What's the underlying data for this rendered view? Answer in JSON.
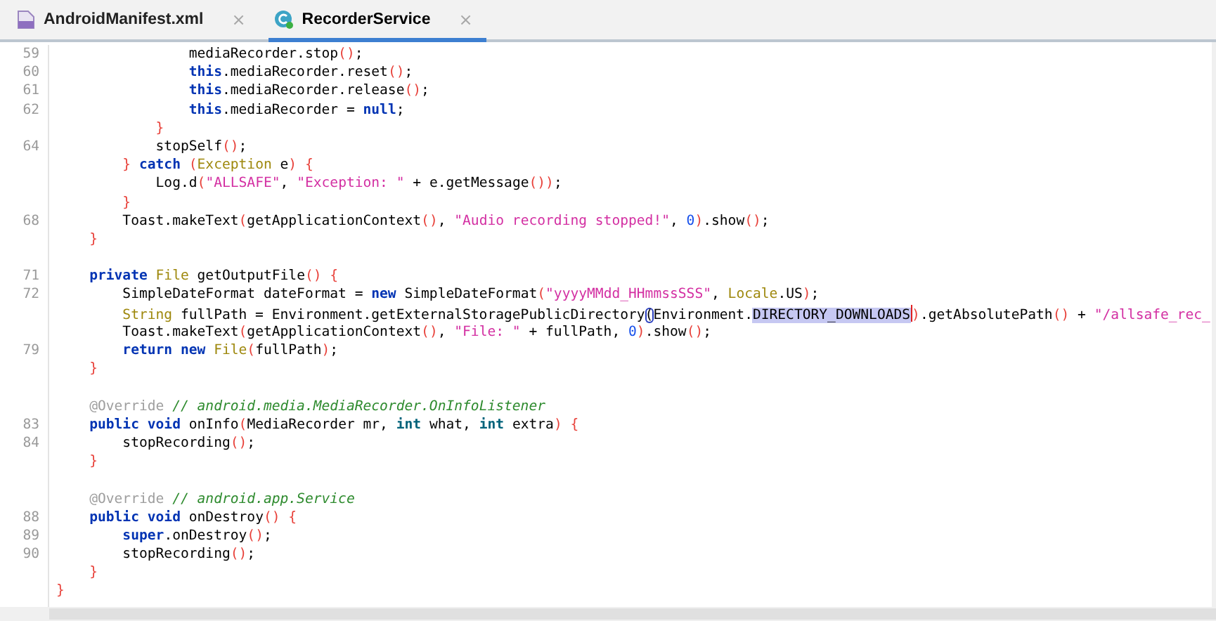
{
  "tabs": [
    {
      "label": "AndroidManifest.xml",
      "close": "×",
      "kind": "manifest",
      "selected": false
    },
    {
      "label": "RecorderService",
      "close": "×",
      "kind": "class",
      "selected": true
    }
  ],
  "lines": [
    {
      "kind": "code",
      "number": "59",
      "tokens": [
        {
          "kind": "plain",
          "text": "                mediaRecorder.stop"
        },
        {
          "kind": "bracket",
          "text": "()"
        },
        {
          "kind": "plain",
          "text": ";"
        }
      ]
    },
    {
      "kind": "code",
      "number": "60",
      "tokens": [
        {
          "kind": "keyword",
          "text": "                this"
        },
        {
          "kind": "plain",
          "text": ".mediaRecorder.reset"
        },
        {
          "kind": "bracket",
          "text": "()"
        },
        {
          "kind": "plain",
          "text": ";"
        }
      ]
    },
    {
      "kind": "code",
      "number": "61",
      "tokens": [
        {
          "kind": "keyword",
          "text": "                this"
        },
        {
          "kind": "plain",
          "text": ".mediaRecorder.release"
        },
        {
          "kind": "bracket",
          "text": "()"
        },
        {
          "kind": "plain",
          "text": ";"
        }
      ]
    },
    {
      "kind": "code",
      "number": "62",
      "tokens": [
        {
          "kind": "keyword",
          "text": "                this"
        },
        {
          "kind": "plain",
          "text": ".mediaRecorder = "
        },
        {
          "kind": "keyword",
          "text": "null"
        },
        {
          "kind": "plain",
          "text": ";"
        }
      ]
    },
    {
      "kind": "code",
      "tokens": [
        {
          "kind": "bracket",
          "text": "            }"
        }
      ]
    },
    {
      "kind": "code",
      "number": "64",
      "tokens": [
        {
          "kind": "plain",
          "text": "            stopSelf"
        },
        {
          "kind": "bracket",
          "text": "()"
        },
        {
          "kind": "plain",
          "text": ";"
        }
      ]
    },
    {
      "kind": "code",
      "tokens": [
        {
          "kind": "bracket",
          "text": "        } "
        },
        {
          "kind": "keyword",
          "text": "catch"
        },
        {
          "kind": "bracket",
          "text": " ("
        },
        {
          "kind": "type",
          "text": "Exception"
        },
        {
          "kind": "plain",
          "text": " e"
        },
        {
          "kind": "bracket",
          "text": ") {"
        }
      ]
    },
    {
      "kind": "code",
      "tokens": [
        {
          "kind": "plain",
          "text": "            Log.d"
        },
        {
          "kind": "bracket",
          "text": "("
        },
        {
          "kind": "string",
          "text": "\"ALLSAFE\""
        },
        {
          "kind": "plain",
          "text": ", "
        },
        {
          "kind": "string",
          "text": "\"Exception: \""
        },
        {
          "kind": "plain",
          "text": " + e.getMessage"
        },
        {
          "kind": "bracket",
          "text": "())"
        },
        {
          "kind": "plain",
          "text": ";"
        }
      ]
    },
    {
      "kind": "code",
      "tokens": [
        {
          "kind": "bracket",
          "text": "        }"
        }
      ]
    },
    {
      "kind": "code",
      "number": "68",
      "tokens": [
        {
          "kind": "plain",
          "text": "        Toast.makeText"
        },
        {
          "kind": "bracket",
          "text": "("
        },
        {
          "kind": "plain",
          "text": "getApplicationContext"
        },
        {
          "kind": "bracket",
          "text": "()"
        },
        {
          "kind": "plain",
          "text": ", "
        },
        {
          "kind": "string",
          "text": "\"Audio recording stopped!\""
        },
        {
          "kind": "plain",
          "text": ", "
        },
        {
          "kind": "number",
          "text": "0"
        },
        {
          "kind": "bracket",
          "text": ")"
        },
        {
          "kind": "plain",
          "text": ".show"
        },
        {
          "kind": "bracket",
          "text": "()"
        },
        {
          "kind": "plain",
          "text": ";"
        }
      ]
    },
    {
      "kind": "code",
      "tokens": [
        {
          "kind": "bracket",
          "text": "    }"
        }
      ]
    },
    {
      "kind": "blank"
    },
    {
      "kind": "code",
      "number": "71",
      "tokens": [
        {
          "kind": "keyword",
          "text": "    private"
        },
        {
          "kind": "type",
          "text": " File"
        },
        {
          "kind": "plain",
          "text": " getOutputFile"
        },
        {
          "kind": "bracket",
          "text": "() {"
        }
      ]
    },
    {
      "kind": "code",
      "number": "72",
      "tokens": [
        {
          "kind": "plain",
          "text": "        SimpleDateFormat dateFormat = "
        },
        {
          "kind": "keyword",
          "text": "new"
        },
        {
          "kind": "plain",
          "text": " SimpleDateFormat"
        },
        {
          "kind": "bracket",
          "text": "("
        },
        {
          "kind": "string",
          "text": "\"yyyyMMdd_HHmmssSSS\""
        },
        {
          "kind": "plain",
          "text": ", "
        },
        {
          "kind": "type",
          "text": "Locale"
        },
        {
          "kind": "plain",
          "text": ".US"
        },
        {
          "kind": "bracket",
          "text": ")"
        },
        {
          "kind": "plain",
          "text": ";"
        }
      ]
    },
    {
      "kind": "code",
      "tokens": [
        {
          "kind": "type",
          "text": "        String"
        },
        {
          "kind": "plain",
          "text": " fullPath = Environment.getExternalStoragePublicDirectory"
        },
        {
          "kind": "matched",
          "text": "("
        },
        {
          "kind": "plain",
          "text": "Environment."
        },
        {
          "kind": "highlight",
          "text": "DIRECTORY_DOWNLOADS",
          "cursor_after": true
        },
        {
          "kind": "bracket",
          "text": ")"
        },
        {
          "kind": "plain",
          "text": ".getAbsolutePath"
        },
        {
          "kind": "bracket",
          "text": "()"
        },
        {
          "kind": "plain",
          "text": " + "
        },
        {
          "kind": "string",
          "text": "\"/allsafe_rec_"
        }
      ]
    },
    {
      "kind": "code",
      "tokens": [
        {
          "kind": "plain",
          "text": "        Toast.makeText"
        },
        {
          "kind": "bracket",
          "text": "("
        },
        {
          "kind": "plain",
          "text": "getApplicationContext"
        },
        {
          "kind": "bracket",
          "text": "()"
        },
        {
          "kind": "plain",
          "text": ", "
        },
        {
          "kind": "string",
          "text": "\"File: \""
        },
        {
          "kind": "plain",
          "text": " + fullPath, "
        },
        {
          "kind": "number",
          "text": "0"
        },
        {
          "kind": "bracket",
          "text": ")"
        },
        {
          "kind": "plain",
          "text": ".show"
        },
        {
          "kind": "bracket",
          "text": "()"
        },
        {
          "kind": "plain",
          "text": ";"
        }
      ]
    },
    {
      "kind": "code",
      "number": "79",
      "tokens": [
        {
          "kind": "keyword",
          "text": "        return new"
        },
        {
          "kind": "type",
          "text": " File"
        },
        {
          "kind": "bracket",
          "text": "("
        },
        {
          "kind": "plain",
          "text": "fullPath"
        },
        {
          "kind": "bracket",
          "text": ")"
        },
        {
          "kind": "plain",
          "text": ";"
        }
      ]
    },
    {
      "kind": "code",
      "tokens": [
        {
          "kind": "bracket",
          "text": "    }"
        }
      ]
    },
    {
      "kind": "blank"
    },
    {
      "kind": "code",
      "tokens": [
        {
          "kind": "annotation",
          "text": "    @Override"
        },
        {
          "kind": "comment",
          "text": " // android.media.MediaRecorder.OnInfoListener"
        }
      ]
    },
    {
      "kind": "code",
      "number": "83",
      "tokens": [
        {
          "kind": "keyword",
          "text": "    public void"
        },
        {
          "kind": "plain",
          "text": " onInfo"
        },
        {
          "kind": "bracket",
          "text": "("
        },
        {
          "kind": "plain",
          "text": "MediaRecorder mr, "
        },
        {
          "kind": "primitive",
          "text": "int"
        },
        {
          "kind": "plain",
          "text": " what, "
        },
        {
          "kind": "primitive",
          "text": "int"
        },
        {
          "kind": "plain",
          "text": " extra"
        },
        {
          "kind": "bracket",
          "text": ") {"
        }
      ]
    },
    {
      "kind": "code",
      "number": "84",
      "tokens": [
        {
          "kind": "plain",
          "text": "        stopRecording"
        },
        {
          "kind": "bracket",
          "text": "()"
        },
        {
          "kind": "plain",
          "text": ";"
        }
      ]
    },
    {
      "kind": "code",
      "tokens": [
        {
          "kind": "bracket",
          "text": "    }"
        }
      ]
    },
    {
      "kind": "blank"
    },
    {
      "kind": "code",
      "tokens": [
        {
          "kind": "annotation",
          "text": "    @Override"
        },
        {
          "kind": "comment",
          "text": " // android.app.Service"
        }
      ]
    },
    {
      "kind": "code",
      "number": "88",
      "tokens": [
        {
          "kind": "keyword",
          "text": "    public void"
        },
        {
          "kind": "plain",
          "text": " onDestroy"
        },
        {
          "kind": "bracket",
          "text": "() {"
        }
      ]
    },
    {
      "kind": "code",
      "number": "89",
      "tokens": [
        {
          "kind": "keyword",
          "text": "        super"
        },
        {
          "kind": "plain",
          "text": ".onDestroy"
        },
        {
          "kind": "bracket",
          "text": "()"
        },
        {
          "kind": "plain",
          "text": ";"
        }
      ]
    },
    {
      "kind": "code",
      "number": "90",
      "tokens": [
        {
          "kind": "plain",
          "text": "        stopRecording"
        },
        {
          "kind": "bracket",
          "text": "()"
        },
        {
          "kind": "plain",
          "text": ";"
        }
      ]
    },
    {
      "kind": "code",
      "tokens": [
        {
          "kind": "bracket",
          "text": "    }"
        }
      ]
    },
    {
      "kind": "code",
      "tokens": [
        {
          "kind": "bracket",
          "text": "}"
        }
      ]
    }
  ]
}
